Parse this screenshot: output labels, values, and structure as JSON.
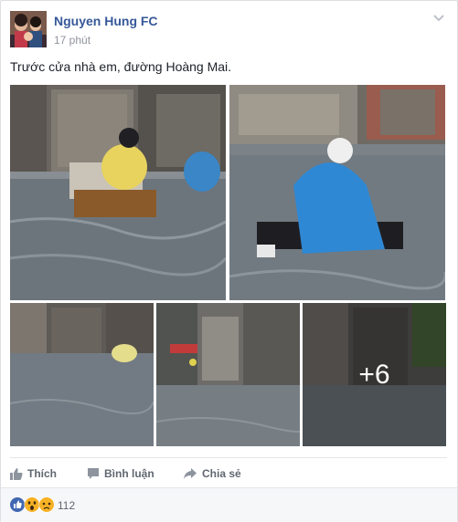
{
  "post": {
    "author": "Nguyen Hung FC",
    "time": "17 phút",
    "text": "Trước cửa nhà em, đường Hoàng Mai.",
    "more_photos": "+6"
  },
  "actions": {
    "like": "Thích",
    "comment": "Bình luận",
    "share": "Chia sẻ"
  },
  "reactions": {
    "count": "112",
    "types": [
      "like-icon",
      "wow-icon",
      "sad-icon"
    ]
  },
  "icons": {
    "menu": "chevron-down-icon",
    "like": "thumbs-up-icon",
    "comment": "comment-icon",
    "share": "share-arrow-icon"
  },
  "colors": {
    "author_link": "#365899",
    "like_blue": "#4267b2",
    "reaction_yellow": "#f7b125"
  }
}
